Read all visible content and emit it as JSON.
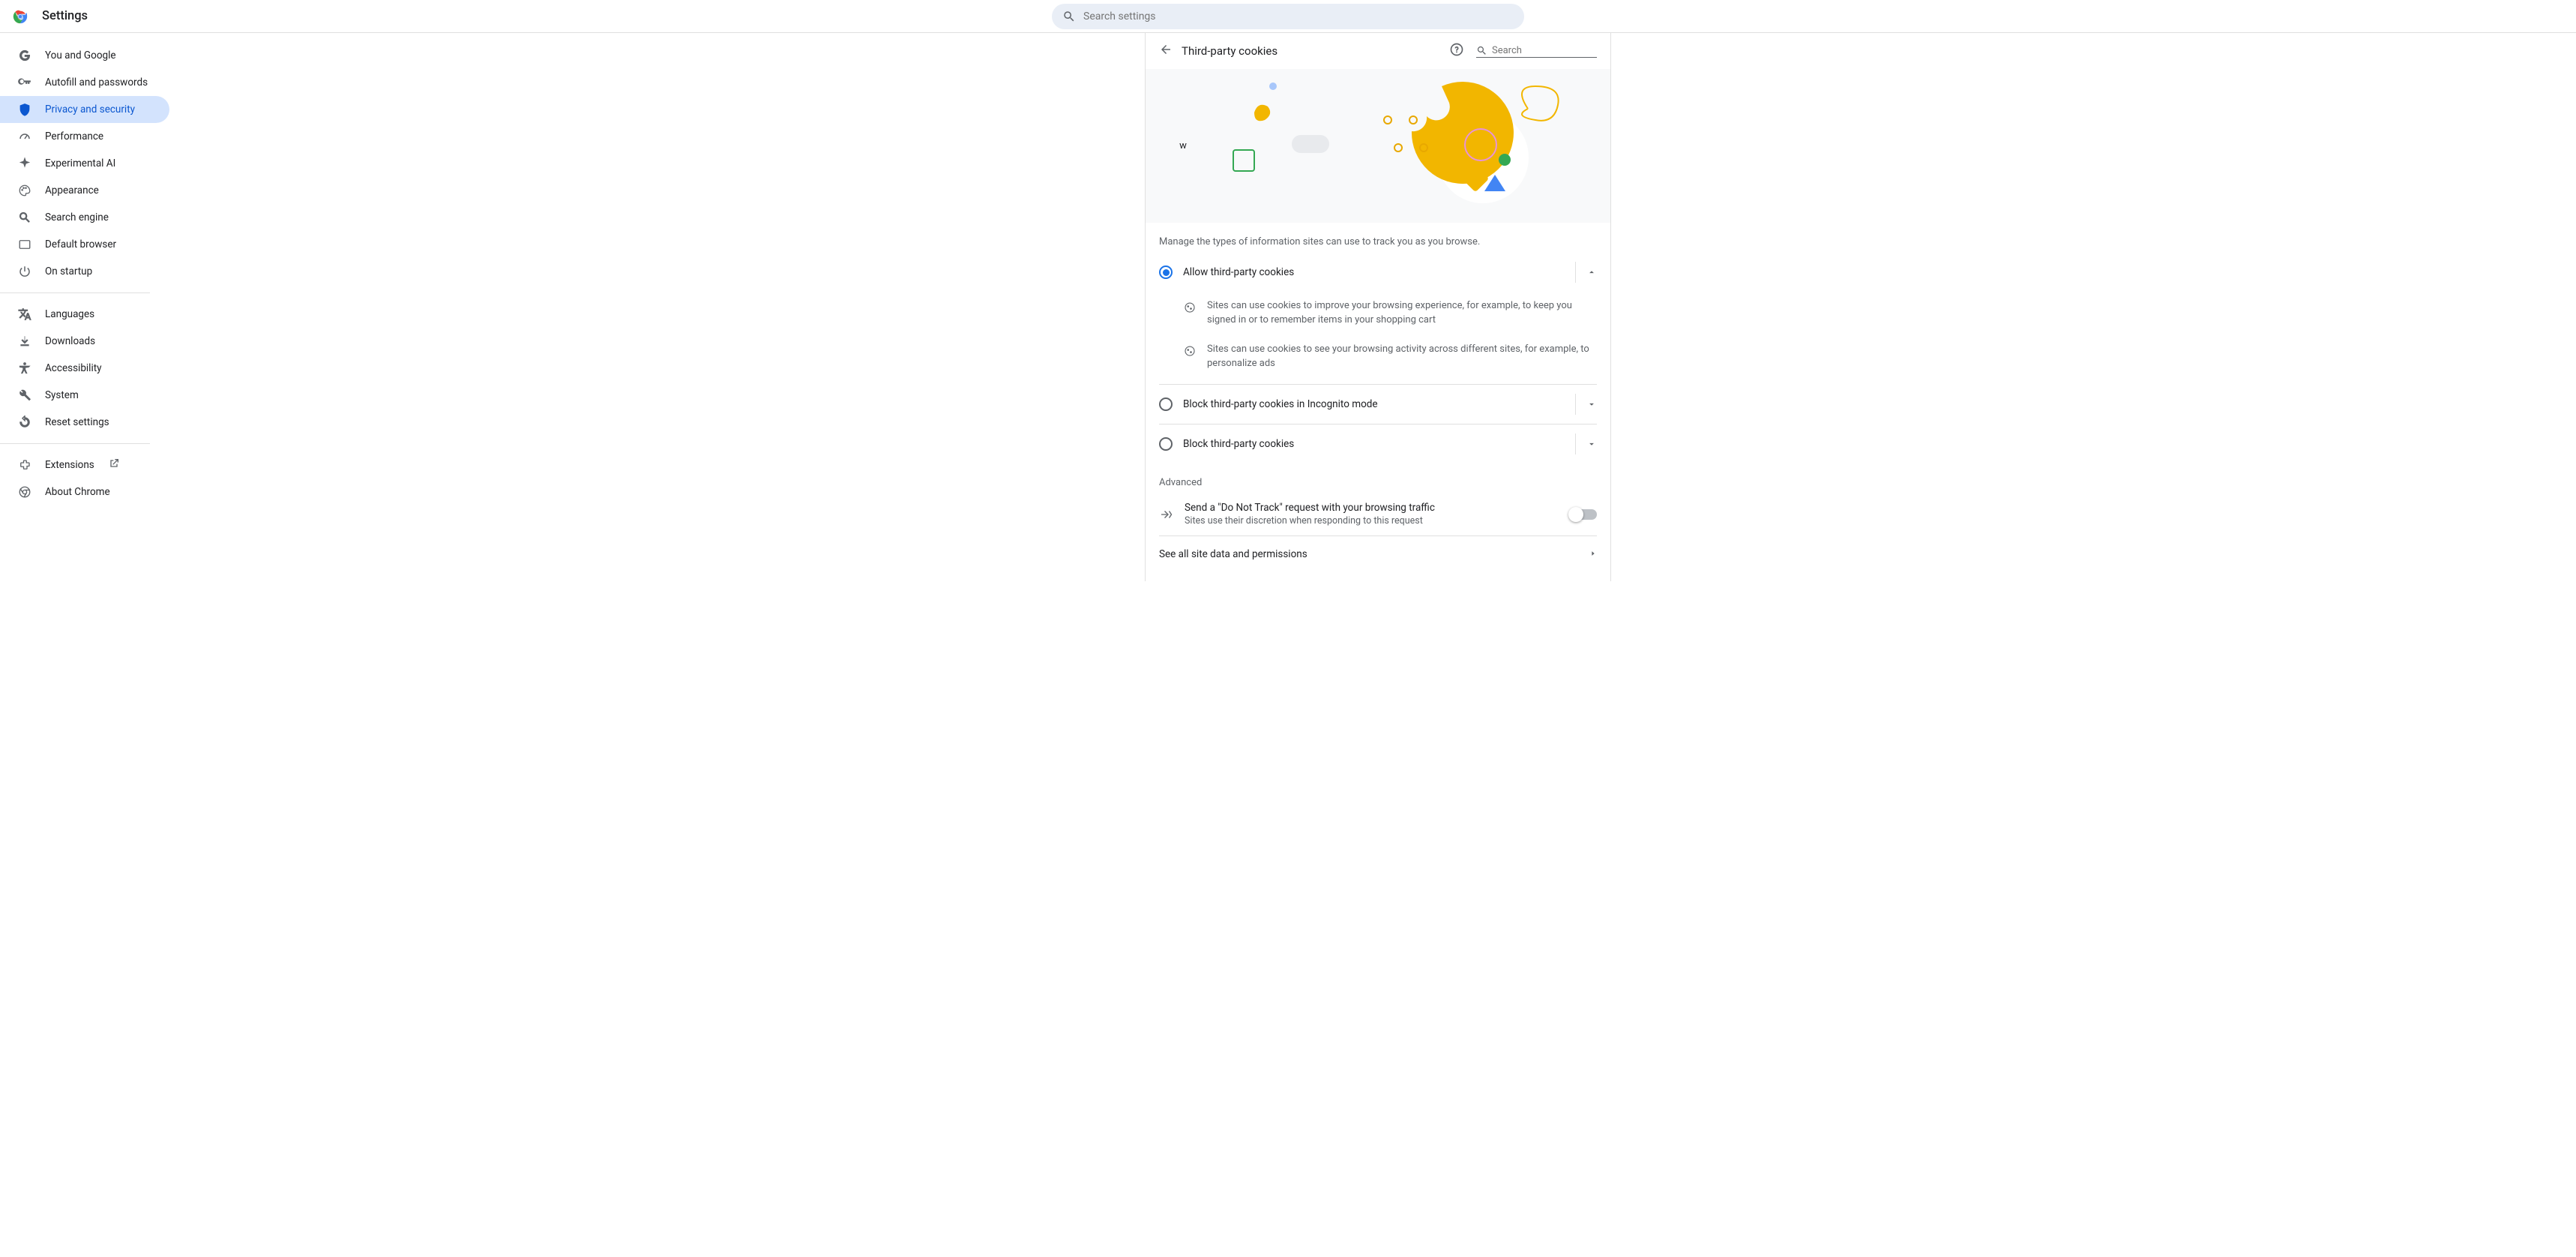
{
  "app_title": "Settings",
  "top_search_placeholder": "Search settings",
  "sidebar": {
    "items": [
      {
        "label": "You and Google"
      },
      {
        "label": "Autofill and passwords"
      },
      {
        "label": "Privacy and security"
      },
      {
        "label": "Performance"
      },
      {
        "label": "Experimental AI"
      },
      {
        "label": "Appearance"
      },
      {
        "label": "Search engine"
      },
      {
        "label": "Default browser"
      },
      {
        "label": "On startup"
      }
    ],
    "group2": [
      {
        "label": "Languages"
      },
      {
        "label": "Downloads"
      },
      {
        "label": "Accessibility"
      },
      {
        "label": "System"
      },
      {
        "label": "Reset settings"
      }
    ],
    "group3": [
      {
        "label": "Extensions"
      },
      {
        "label": "About Chrome"
      }
    ]
  },
  "panel": {
    "title": "Third-party cookies",
    "search_placeholder": "Search",
    "description": "Manage the types of information sites can use to track you as you browse.",
    "options": [
      {
        "label": "Allow third-party cookies",
        "checked": true,
        "expanded": true,
        "details": [
          "Sites can use cookies to improve your browsing experience, for example, to keep you signed in or to remember items in your shopping cart",
          "Sites can use cookies to see your browsing activity across different sites, for example, to personalize ads"
        ]
      },
      {
        "label": "Block third-party cookies in Incognito mode",
        "checked": false,
        "expanded": false
      },
      {
        "label": "Block third-party cookies",
        "checked": false,
        "expanded": false
      }
    ],
    "advanced_label": "Advanced",
    "dnt": {
      "title": "Send a \"Do Not Track\" request with your browsing traffic",
      "subtitle": "Sites use their discretion when responding to this request",
      "enabled": false
    },
    "site_data_link": "See all site data and permissions"
  }
}
